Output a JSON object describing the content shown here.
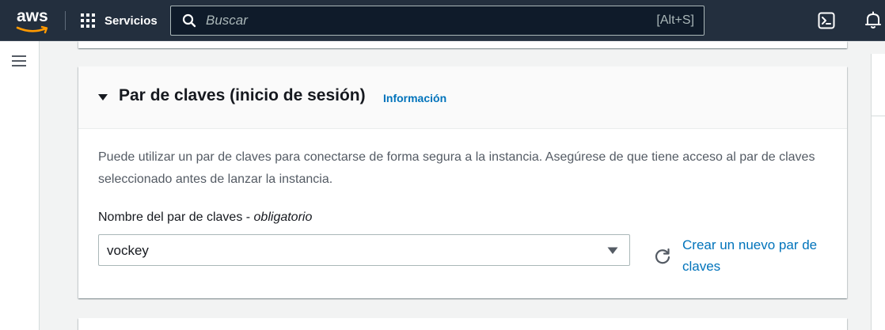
{
  "topnav": {
    "logo_text": "aws",
    "services_label": "Servicios",
    "search": {
      "placeholder": "Buscar",
      "shortcut": "[Alt+S]"
    },
    "icons": [
      "grid-icon",
      "search-icon",
      "cloudshell-icon",
      "bell-icon"
    ]
  },
  "sidebar": {
    "menu_icon": "hamburger-menu-icon"
  },
  "key_pair_section": {
    "title": "Par de claves (inicio de sesión)",
    "info_link": "Información",
    "description": "Puede utilizar un par de claves para conectarse de forma segura a la instancia. Asegúrese de que tiene acceso al par de claves seleccionado antes de lanzar la instancia.",
    "field_label": "Nombre del par de claves - ",
    "field_required": "obligatorio",
    "selected_key": "vockey",
    "create_link": "Crear un nuevo par de claves"
  },
  "colors": {
    "nav_background": "#232f3e",
    "link": "#0073bb",
    "page_background": "#f2f3f3"
  }
}
